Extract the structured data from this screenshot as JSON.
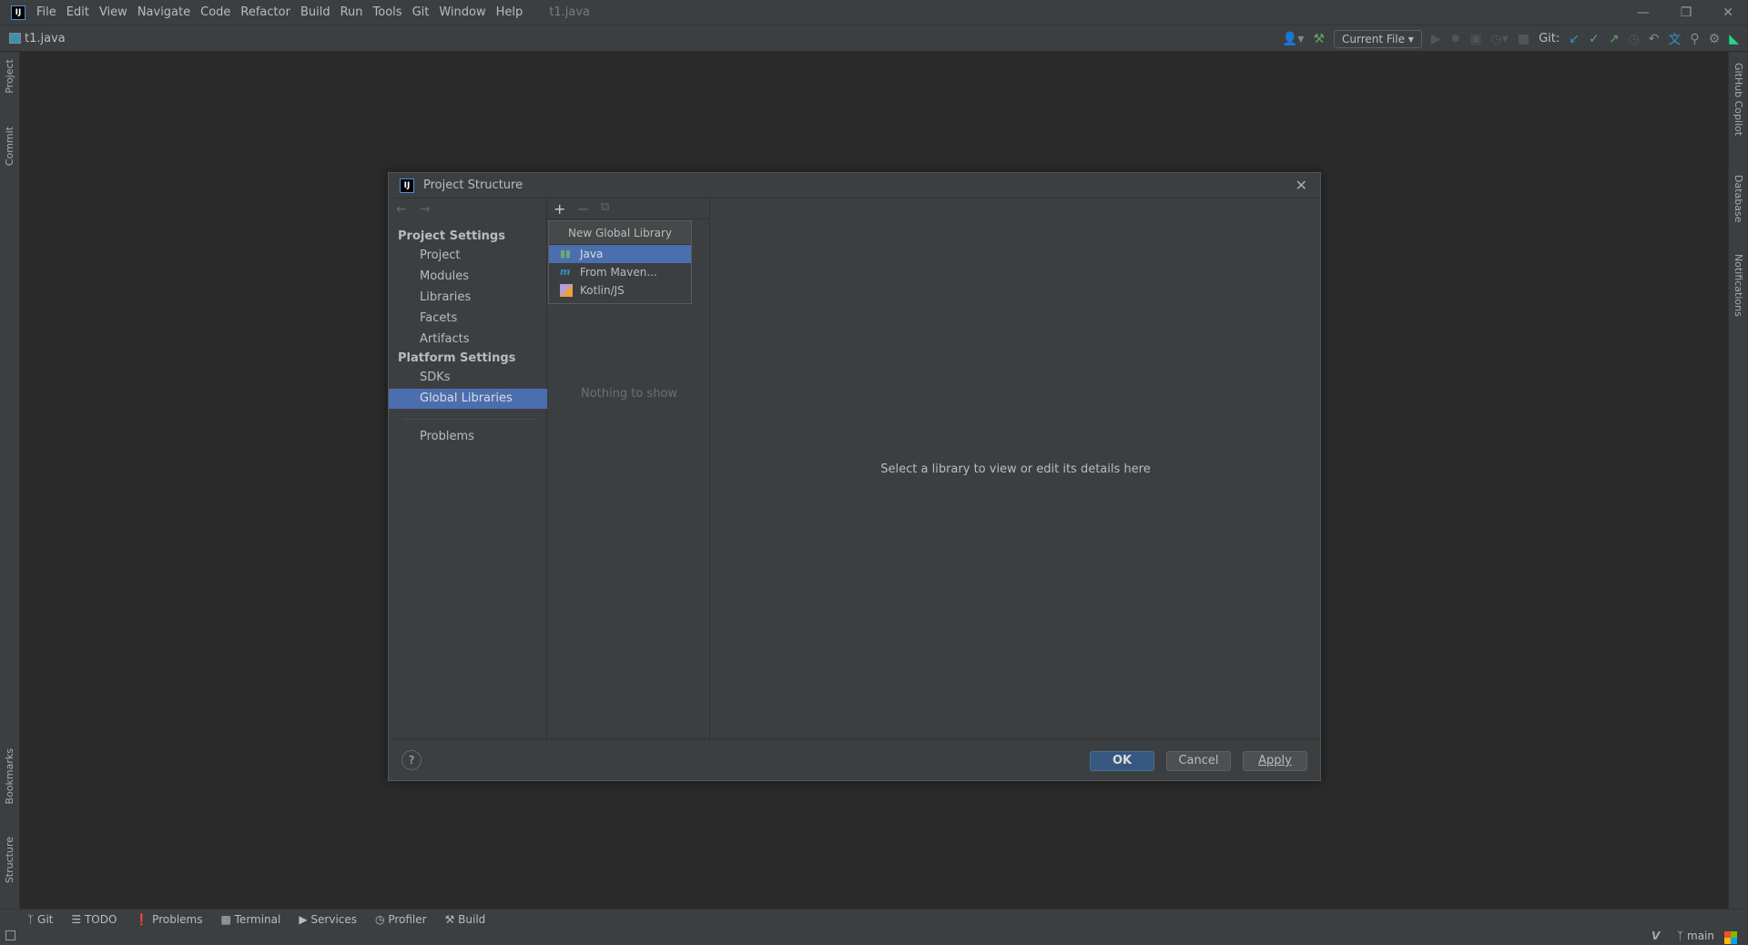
{
  "menubar": {
    "items": [
      "File",
      "Edit",
      "View",
      "Navigate",
      "Code",
      "Refactor",
      "Build",
      "Run",
      "Tools",
      "Git",
      "Window",
      "Help"
    ],
    "window_title": "t1.java"
  },
  "navbar": {
    "file": "t1.java",
    "run_config": "Current File",
    "git_label": "Git:"
  },
  "left_strip": [
    "Project",
    "Commit",
    "Bookmarks",
    "Structure"
  ],
  "right_strip": [
    "GitHub Copilot",
    "Database",
    "Notifications"
  ],
  "bottom_tabs": [
    "Git",
    "TODO",
    "Problems",
    "Terminal",
    "Services",
    "Profiler",
    "Build"
  ],
  "status": {
    "branch": "main"
  },
  "dialog": {
    "title": "Project Structure",
    "project_settings_header": "Project Settings",
    "project_settings": [
      "Project",
      "Modules",
      "Libraries",
      "Facets",
      "Artifacts"
    ],
    "platform_settings_header": "Platform Settings",
    "platform_settings": [
      "SDKs",
      "Global Libraries"
    ],
    "selected": "Global Libraries",
    "problems": "Problems",
    "empty_list": "Nothing to show",
    "detail_hint": "Select a library to view or edit its details here",
    "popup": {
      "header": "New Global Library",
      "items": [
        "Java",
        "From Maven...",
        "Kotlin/JS"
      ],
      "selected": "Java"
    },
    "ok": "OK",
    "cancel": "Cancel",
    "apply": "Apply",
    "help": "?"
  },
  "colors": {
    "selection": "#4b6eaf",
    "ok_button": "#365880",
    "background": "#2b2b2b",
    "panel": "#3c3f41"
  }
}
